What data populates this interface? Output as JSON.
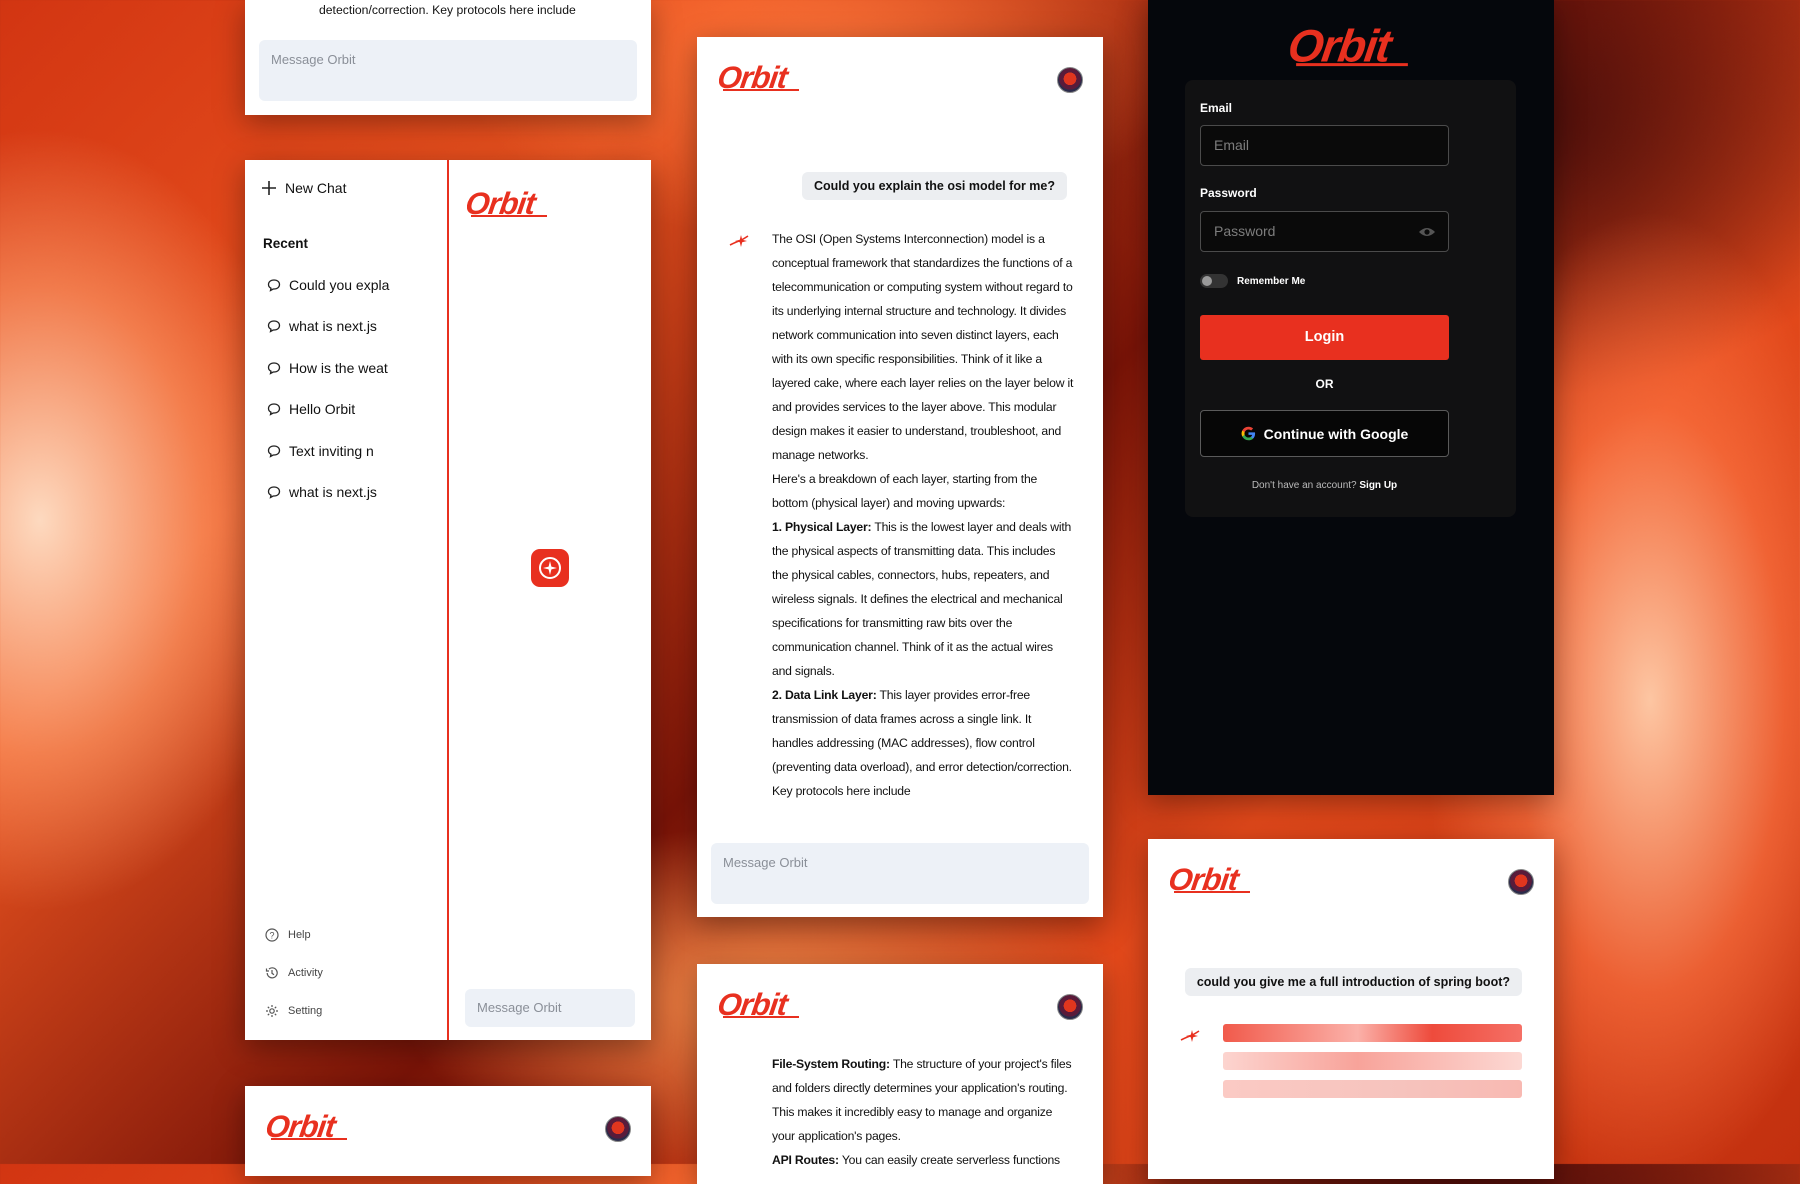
{
  "app": {
    "name": "Orbit",
    "brand_color": "#e8301f"
  },
  "common": {
    "message_placeholder": "Message Orbit"
  },
  "top_snippet": {
    "text": "detection/correction. Key protocols here include"
  },
  "sidebar": {
    "new_chat_label": "New Chat",
    "recent_heading": "Recent",
    "recent_items": [
      {
        "label": "Could you expla"
      },
      {
        "label": "what is next.js"
      },
      {
        "label": "How is the weat"
      },
      {
        "label": "Hello Orbit"
      },
      {
        "label": "Text inviting n"
      },
      {
        "label": "what is next.js"
      }
    ],
    "footer": {
      "help": "Help",
      "activity": "Activity",
      "setting": "Setting"
    }
  },
  "chat_osi": {
    "user_question": "Could you explain the osi model for me?",
    "response": {
      "intro": "The OSI (Open Systems Interconnection) model is a conceptual framework that standardizes the functions of a telecommunication or computing system without regard to its underlying internal structure and technology. It divides network communication into seven distinct layers, each with its own specific responsibilities. Think of it like a layered cake, where each layer relies on the layer below it and provides services to the layer above. This modular design makes it easier to understand, troubleshoot, and manage networks.",
      "breakdown": "Here's a breakdown of each layer, starting from the bottom (physical layer) and moving upwards:",
      "layers": [
        {
          "title": "1. Physical Layer:",
          "text": "This is the lowest layer and deals with the physical aspects of transmitting data. This includes the physical cables, connectors, hubs, repeaters, and wireless signals. It defines the electrical and mechanical specifications for transmitting raw bits over the communication channel. Think of it as the actual wires and signals."
        },
        {
          "title": "2. Data Link Layer:",
          "text": "This layer provides error-free transmission of data frames across a single link. It handles addressing (MAC addresses), flow control (preventing data overload), and error detection/correction. Key protocols here include"
        }
      ]
    }
  },
  "chat_nextjs": {
    "items": [
      {
        "title": "File-System Routing:",
        "text": "The structure of your project's files and folders directly determines your application's routing. This makes it incredibly easy to manage and organize your application's pages."
      },
      {
        "title": "API Routes:",
        "text": "You can easily create serverless functions"
      }
    ]
  },
  "login": {
    "email_label": "Email",
    "email_placeholder": "Email",
    "password_label": "Password",
    "password_placeholder": "Password",
    "remember_label": "Remember Me",
    "login_button": "Login",
    "or_label": "OR",
    "google_button": "Continue with Google",
    "no_account_text": "Don't have an account?",
    "signup_link": "Sign Up"
  },
  "chat_spring": {
    "user_question": "could you give me a full introduction of spring boot?",
    "loading_bar_count": 3
  },
  "icons": {
    "plus": "plus-icon",
    "chat": "chat-bubble-icon",
    "help": "help-circle-icon",
    "activity": "history-icon",
    "setting": "gear-icon",
    "eye": "eye-icon",
    "google": "google-g-icon",
    "sparkle": "sparkle-icon"
  }
}
